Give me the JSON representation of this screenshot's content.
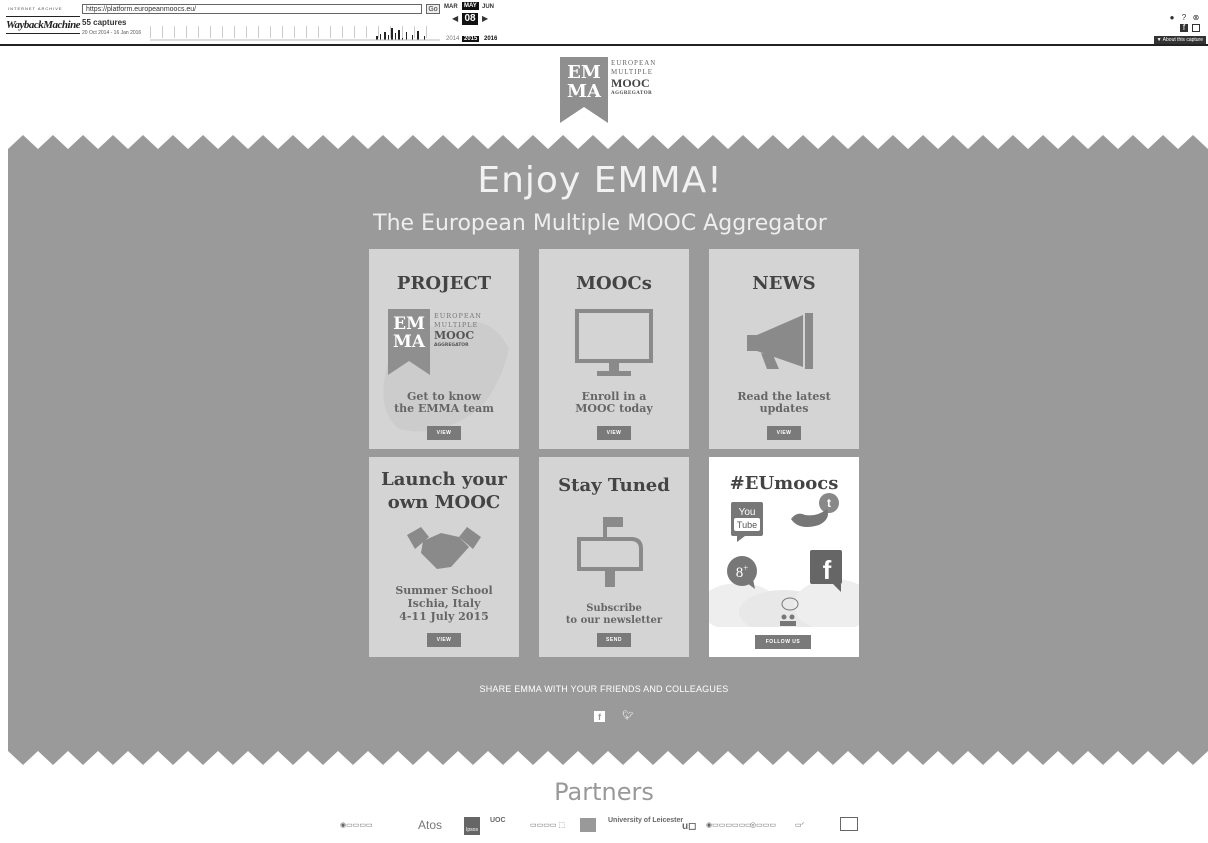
{
  "wayback": {
    "brand_top": "INTERNET ARCHIVE",
    "brand": "WaybackMachine",
    "url": "https://platform.europeanmoocs.eu/",
    "go_label": "Go",
    "captures": "55 captures",
    "range": "20 Oct 2014 - 16 Jan 2016",
    "month_prev": "MAR",
    "month_cur": "MAY",
    "month_next": "JUN",
    "day": "08",
    "year_prev": "2014",
    "year_cur": "2015",
    "year_next": "2016",
    "about": "▼ About this capture"
  },
  "logo": {
    "em": "EM",
    "ma": "MA",
    "line1": "EUROPEAN",
    "line2": "MULTIPLE",
    "line3": "MOOC",
    "line4": "AGGREGATOR"
  },
  "hero": {
    "title": "Enjoy EMMA!",
    "subtitle": "The European Multiple MOOC Aggregator"
  },
  "cards": {
    "project": {
      "title": "PROJECT",
      "desc1": "Get to know",
      "desc2": "the EMMA team",
      "button": "VIEW"
    },
    "moocs": {
      "title": "MOOCs",
      "desc1": "Enroll in a",
      "desc2": "MOOC today",
      "button": "VIEW"
    },
    "news": {
      "title": "NEWS",
      "desc1": "Read the latest",
      "desc2": "updates",
      "button": "VIEW"
    },
    "launch": {
      "title1": "Launch your",
      "title2": "own MOOC",
      "desc1": "Summer School",
      "desc2": "Ischia, Italy",
      "desc3": "4-11 July 2015",
      "button": "VIEW"
    },
    "tuned": {
      "title": "Stay Tuned",
      "desc1": "Subscribe",
      "desc2": "to our newsletter",
      "button": "SEND"
    },
    "social": {
      "title": "#EUmoocs",
      "button": "FOLLOW US",
      "youtube1": "You",
      "youtube2": "Tube"
    }
  },
  "share": {
    "text": "SHARE EMMA WITH YOUR FRIENDS AND COLLEAGUES"
  },
  "partners": {
    "title": "Partners",
    "logos": [
      "Atos",
      "Ipsos",
      "UOC",
      "University of Leicester"
    ]
  },
  "colors": {
    "band": "#9a9a9a",
    "card": "#d4d4d4",
    "button": "#7a7a7a"
  }
}
